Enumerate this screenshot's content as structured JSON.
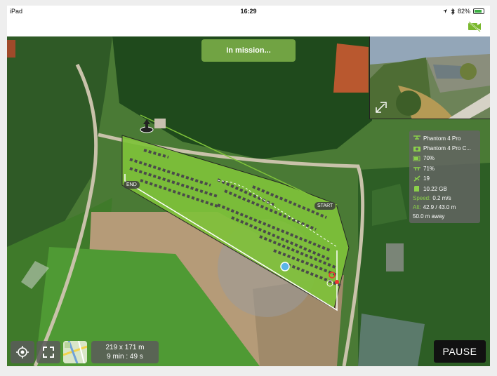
{
  "status_bar": {
    "device": "iPad",
    "time": "16:29",
    "battery": "82%",
    "battery_level": 0.82
  },
  "mission_banner": "In mission...",
  "map_labels": {
    "start": "START",
    "end": "END"
  },
  "telemetry": {
    "aircraft": "Phantom 4 Pro",
    "camera": "Phantom 4 Pro C...",
    "drone_battery": "70%",
    "rc_battery": "71%",
    "satellites": "19",
    "storage": "10.22 GB",
    "speed_label": "Speed:",
    "speed_value": "0.2 m/s",
    "alt_label": "Alt:",
    "alt_value": "42.9 / 43.0 m",
    "distance": "50.0 m away"
  },
  "stats": {
    "area": "219 x 171 m",
    "duration": "9 min : 49 s"
  },
  "buttons": {
    "pause": "PAUSE"
  },
  "icons": [
    "location-icon",
    "bluetooth-icon",
    "battery-icon",
    "camera-off-icon",
    "expand-icon",
    "drone-icon",
    "camera-icon",
    "battery-icon",
    "remote-icon",
    "satellite-icon",
    "sd-card-icon",
    "locate-icon",
    "fullscreen-icon",
    "map-icon"
  ],
  "colors": {
    "mission_area": "#7fc23a",
    "accent_green": "#8bd14a",
    "pause_bg": "#111111"
  }
}
